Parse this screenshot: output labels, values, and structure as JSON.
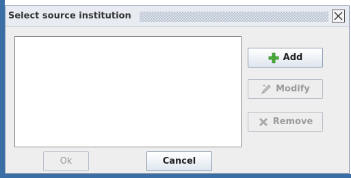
{
  "dialog": {
    "title": "Select source institution",
    "close_icon": "close-x-icon"
  },
  "institution_list": {
    "items": []
  },
  "actions": {
    "add": {
      "label": "Add",
      "icon": "plus-icon",
      "enabled": true
    },
    "modify": {
      "label": "Modify",
      "icon": "edit-icon",
      "enabled": false
    },
    "remove": {
      "label": "Remove",
      "icon": "remove-x-icon",
      "enabled": false
    }
  },
  "footer": {
    "ok": {
      "label": "Ok",
      "enabled": false
    },
    "cancel": {
      "label": "Cancel",
      "enabled": true
    }
  },
  "colors": {
    "frame": "#3b6ea5",
    "add_icon": "#4caf3a"
  }
}
